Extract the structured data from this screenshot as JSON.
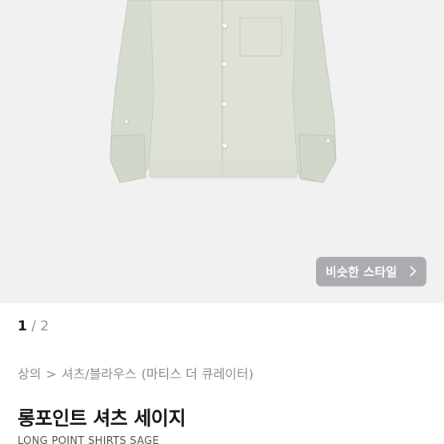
{
  "product_image": {
    "icon": "shirt-image",
    "shirt_color": "#d6dbcf",
    "background_color": "#f1f1f2"
  },
  "similar_style_button": {
    "label": "비슷한 스타일",
    "icon": "chevron-right-icon"
  },
  "pager": {
    "current": "1",
    "separator": " / ",
    "total": "2"
  },
  "breadcrumb": {
    "category": "상의",
    "separator": ">",
    "subcategory": "셔츠/블라우스",
    "curator": "(마티스 더 큐레이터)"
  },
  "product": {
    "title": "롱포인트 셔츠 세이지",
    "subtitle": "LONG POINT SHIRTS SAGE"
  }
}
